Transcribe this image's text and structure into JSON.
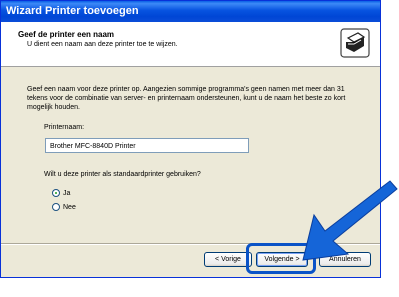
{
  "window": {
    "title": "Wizard Printer toevoegen"
  },
  "header": {
    "title": "Geef de printer een naam",
    "subtitle": "U dient een naam aan deze printer toe te wijzen."
  },
  "body": {
    "description": "Geef een naam voor deze printer op. Aangezien sommige programma's geen namen met meer dan 31 tekens voor de combinatie van server- en printernaam ondersteunen, kunt u de naam het beste zo kort mogelijk houden.",
    "printer_name_label": "Printernaam:",
    "printer_name_value": "Brother MFC-8840D Printer",
    "default_question": "Wilt u deze printer als standaardprinter gebruiken?",
    "radio_yes": "Ja",
    "radio_no": "Nee",
    "selected": "Ja"
  },
  "buttons": {
    "back": "< Vorige",
    "next": "Volgende >",
    "cancel": "Annuleren"
  },
  "colors": {
    "accent_ring": "#0a53c7",
    "arrow": "#1565d8"
  }
}
